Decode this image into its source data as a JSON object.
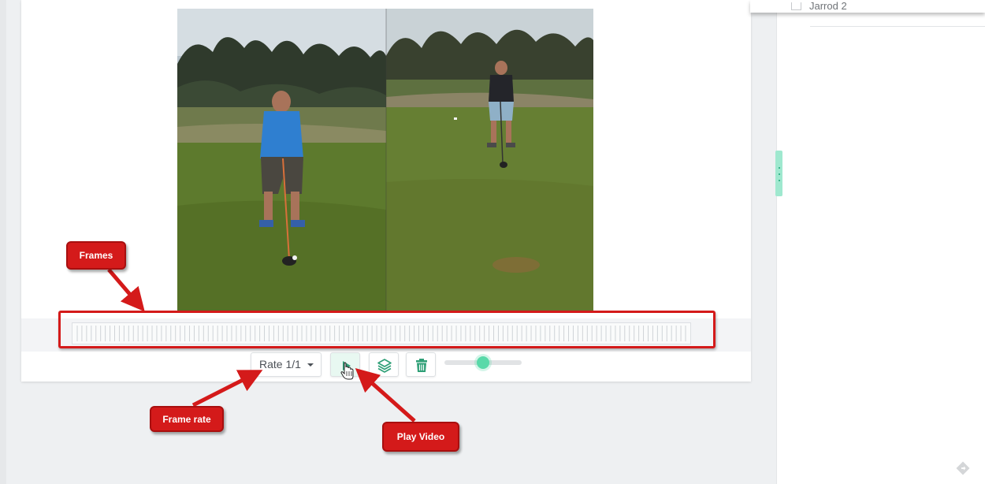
{
  "sidebar": {
    "top_item_label": "Jarrod 2"
  },
  "video": {
    "frame_count": 130
  },
  "toolbar": {
    "rate_label": "Rate 1/1",
    "slider_value": 0.5,
    "accent_color": "#59d9a9"
  },
  "annotations": {
    "frames": "Frames",
    "frame_rate": "Frame rate",
    "play_video": "Play Video",
    "color": "#d41a1a"
  },
  "icons": {
    "play": "play-icon",
    "layers": "layers-icon",
    "trash": "trash-icon",
    "cursor": "hand-cursor-icon",
    "corner": "diamond-arrow-icon"
  }
}
